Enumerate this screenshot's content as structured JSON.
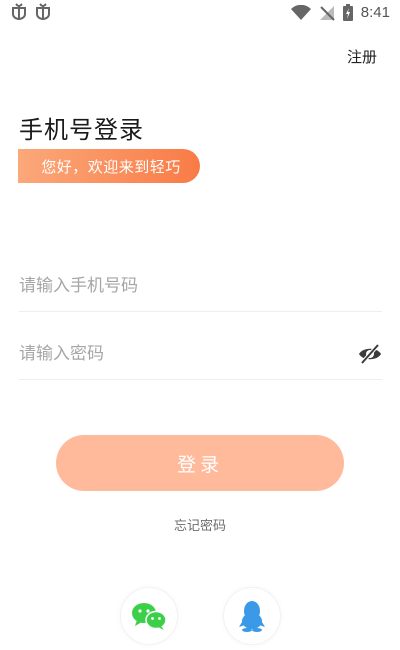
{
  "status_bar": {
    "time": "8:41"
  },
  "header": {
    "register_label": "注册"
  },
  "login": {
    "title": "手机号登录",
    "welcome": "您好，欢迎来到轻巧",
    "phone_placeholder": "请输入手机号码",
    "password_placeholder": "请输入密码",
    "submit_label": "登录",
    "forgot_label": "忘记密码"
  },
  "social": {
    "icons": [
      "wechat-icon",
      "qq-icon"
    ]
  },
  "colors": {
    "accent_gradient_start": "#fba87a",
    "accent_gradient_end": "#f97b46",
    "button": "#ffb99b",
    "wechat": "#3ccf4a",
    "qq": "#3a9ae8"
  }
}
